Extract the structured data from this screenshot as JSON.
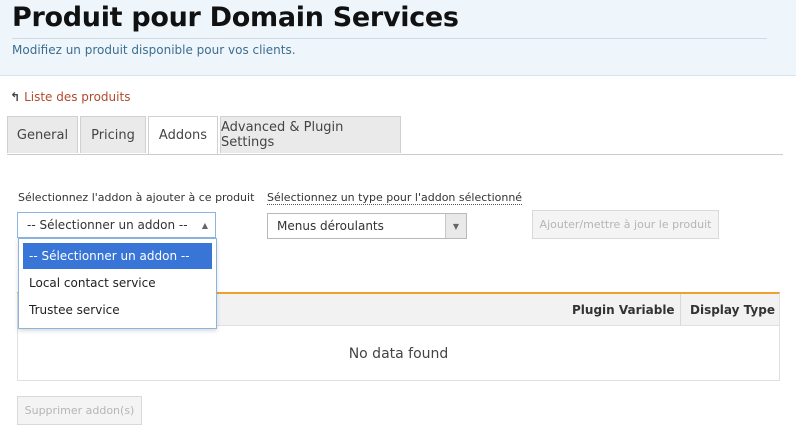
{
  "header": {
    "title": "Produit pour Domain Services",
    "subtitle": "Modifiez un produit disponible pour vos clients."
  },
  "back_link": {
    "icon": "↰",
    "label": "Liste des produits"
  },
  "tabs": [
    {
      "label": "General",
      "active": false
    },
    {
      "label": "Pricing",
      "active": false
    },
    {
      "label": "Addons",
      "active": true
    },
    {
      "label": "Advanced & Plugin Settings",
      "active": false
    }
  ],
  "addon_form": {
    "addon_label": "Sélectionnez l'addon à ajouter à ce produit",
    "addon_select_value": "-- Sélectionner un addon --",
    "type_label": "Sélectionnez un type pour l'addon sélectionné",
    "type_select_value": "Menus déroulants",
    "update_button": "Ajouter/mettre à jour le produit"
  },
  "addon_dropdown": {
    "options": [
      "-- Sélectionner un addon --",
      "Local contact service",
      "Trustee service"
    ],
    "highlighted_index": 0
  },
  "table": {
    "columns": [
      "Plugin Variable",
      "Display Type"
    ],
    "empty_message": "No data found"
  },
  "remove_button": "Supprimer addon(s)",
  "colors": {
    "header_bg": "#eef6fc",
    "link": "#b24a2d",
    "table_accent": "#f0a030",
    "dropdown_highlight": "#3875d7"
  }
}
